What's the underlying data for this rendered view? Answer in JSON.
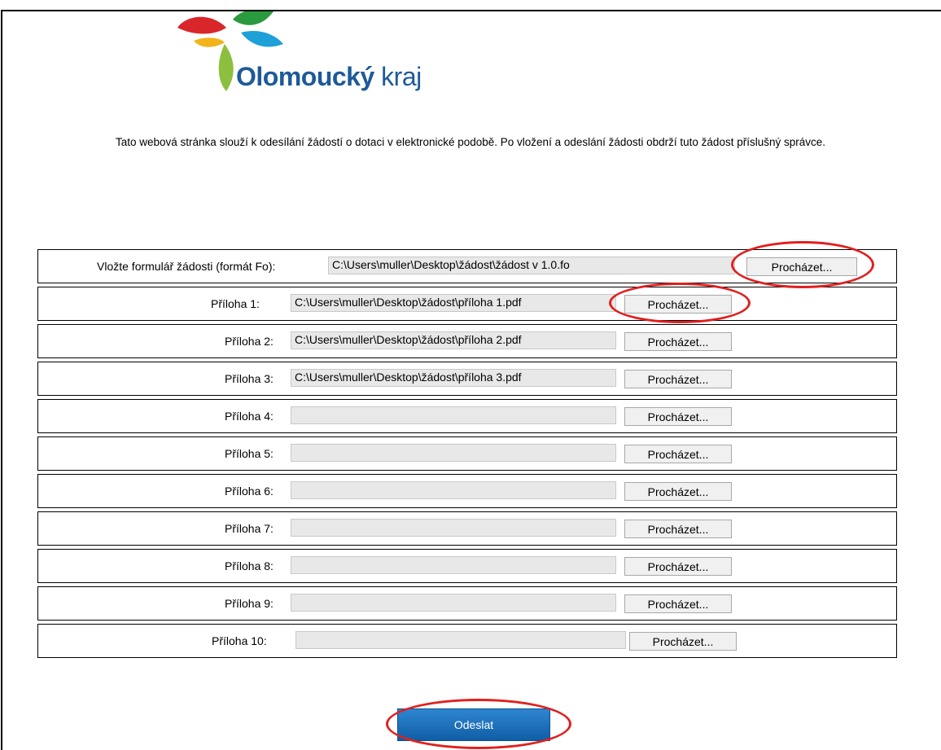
{
  "logo": {
    "name_bold": "Olomoucký",
    "name_regular": "kraj"
  },
  "intro_text": "Tato webová stránka slouží k odesílání žádostí o dotaci v elektronické podobě. Po vložení a odeslání žádosti obdrží tuto žádost příslušný správce.",
  "form": {
    "main_label": "Vložte formulář žádosti (formát Fo):",
    "main_value": "C:\\Users\\muller\\Desktop\\žádost\\žádost v 1.0.fo",
    "browse_label": "Procházet...",
    "attachments": [
      {
        "label": "Příloha 1:",
        "value": "C:\\Users\\muller\\Desktop\\žádost\\příloha 1.pdf"
      },
      {
        "label": "Příloha 2:",
        "value": "C:\\Users\\muller\\Desktop\\žádost\\příloha 2.pdf"
      },
      {
        "label": "Příloha 3:",
        "value": "C:\\Users\\muller\\Desktop\\žádost\\příloha 3.pdf"
      },
      {
        "label": "Příloha 4:",
        "value": ""
      },
      {
        "label": "Příloha 5:",
        "value": ""
      },
      {
        "label": "Příloha 6:",
        "value": ""
      },
      {
        "label": "Příloha 7:",
        "value": ""
      },
      {
        "label": "Příloha 8:",
        "value": ""
      },
      {
        "label": "Příloha 9:",
        "value": ""
      },
      {
        "label": "Příloha 10:",
        "value": ""
      }
    ],
    "submit_label": "Odeslat"
  },
  "colors": {
    "accent_blue": "#1d5a99",
    "highlight_red": "#e0201f",
    "submit_blue": "#1570bd"
  }
}
